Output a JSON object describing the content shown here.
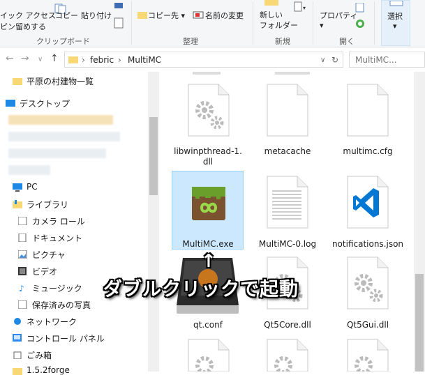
{
  "ribbon": {
    "copy_path": "イック アクセス",
    "pin": "ピン留めする",
    "copy": "コピー",
    "paste": "貼り付け",
    "clipboard_group": "クリップボード",
    "copy_to": "コピー先",
    "rename": "名前の変更",
    "organize_group": "整理",
    "new_folder": "新しい\nフォルダー",
    "new_group": "新規",
    "properties": "プロパティ",
    "open_group": "開く",
    "select": "選択"
  },
  "address": {
    "crumb1": "febric",
    "crumb2": "MultiMC",
    "search_placeholder": "MultiMC..."
  },
  "nav_pane": {
    "items": [
      {
        "label": "平原の村建物一覧",
        "icon": "folder-icon"
      },
      {
        "label": "デスクトップ",
        "icon": "desktop-icon"
      },
      {
        "label": "PC",
        "icon": "pc-icon"
      },
      {
        "label": "ライブラリ",
        "icon": "library-icon"
      },
      {
        "label": "カメラ ロール",
        "icon": "camera-roll-icon"
      },
      {
        "label": "ドキュメント",
        "icon": "documents-icon"
      },
      {
        "label": "ピクチャ",
        "icon": "pictures-icon"
      },
      {
        "label": "ビデオ",
        "icon": "videos-icon"
      },
      {
        "label": "ミュージック",
        "icon": "music-icon"
      },
      {
        "label": "保存済みの写真",
        "icon": "saved-pictures-icon"
      },
      {
        "label": "ネットワーク",
        "icon": "network-icon"
      },
      {
        "label": "コントロール パネル",
        "icon": "control-panel-icon"
      },
      {
        "label": "ごみ箱",
        "icon": "recycle-bin-icon"
      },
      {
        "label": "1.5.2forge",
        "icon": "folder-icon"
      }
    ]
  },
  "files": [
    {
      "name": "libwinpthread-1.\ndll",
      "icon": "gear-file-icon"
    },
    {
      "name": "metacache",
      "icon": "blank-file-icon"
    },
    {
      "name": "multimc.cfg",
      "icon": "blank-file-icon"
    },
    {
      "name": "MultiMC.exe",
      "icon": "multimc-icon"
    },
    {
      "name": "MultiMC-0.log",
      "icon": "text-file-icon"
    },
    {
      "name": "notifications.json",
      "icon": "vscode-icon"
    },
    {
      "name": "qt.conf",
      "icon": "mac-installer-icon"
    },
    {
      "name": "Qt5Core.dll",
      "icon": "gear-file-icon"
    },
    {
      "name": "Qt5Gui.dll",
      "icon": "gear-file-icon"
    }
  ],
  "annotation": {
    "arrow": "↑",
    "text": "ダブルクリックで起動"
  },
  "colors": {
    "selection": "#cce8ff",
    "folder": "#f8d775",
    "vscode_blue": "#0078d4",
    "multimc_green": "#6a9f2b"
  }
}
